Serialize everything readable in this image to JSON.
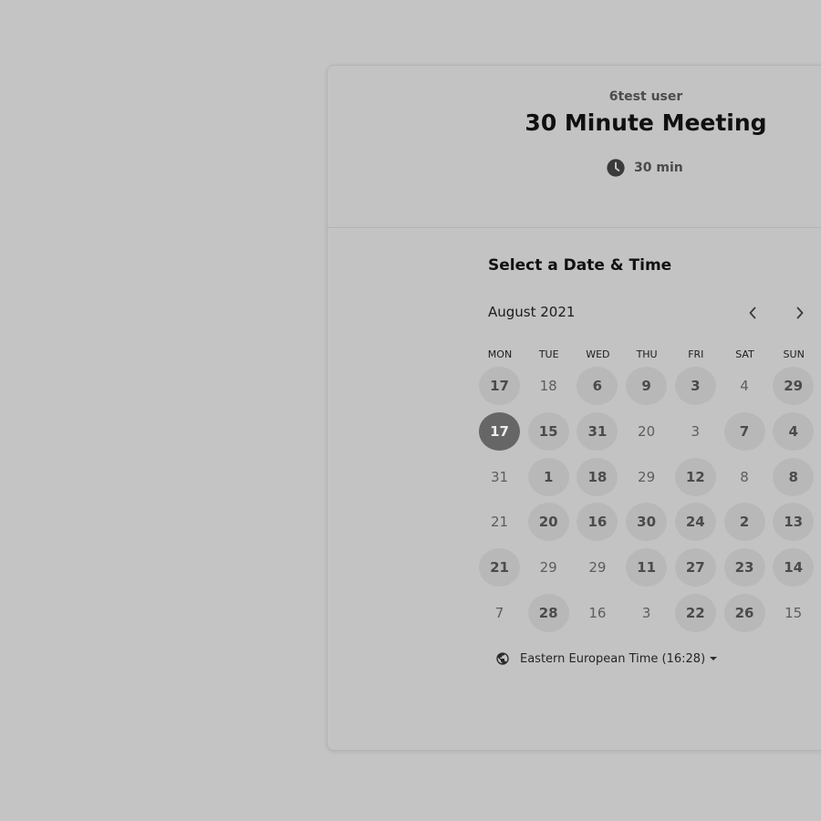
{
  "event": {
    "owner": "6test user",
    "title": "30 Minute Meeting",
    "duration": "30 min"
  },
  "calendar": {
    "section_title": "Select a Date & Time",
    "month_label": "August 2021",
    "weekdays": [
      "MON",
      "TUE",
      "WED",
      "THU",
      "FRI",
      "SAT",
      "SUN"
    ],
    "weeks": [
      [
        {
          "label": "17",
          "state": "available"
        },
        {
          "label": "18",
          "state": "disabled"
        },
        {
          "label": "6",
          "state": "available"
        },
        {
          "label": "9",
          "state": "available"
        },
        {
          "label": "3",
          "state": "available"
        },
        {
          "label": "4",
          "state": "disabled"
        },
        {
          "label": "29",
          "state": "available"
        }
      ],
      [
        {
          "label": "17",
          "state": "selected"
        },
        {
          "label": "15",
          "state": "available"
        },
        {
          "label": "31",
          "state": "available"
        },
        {
          "label": "20",
          "state": "disabled"
        },
        {
          "label": "3",
          "state": "disabled"
        },
        {
          "label": "7",
          "state": "available"
        },
        {
          "label": "4",
          "state": "available"
        }
      ],
      [
        {
          "label": "31",
          "state": "disabled"
        },
        {
          "label": "1",
          "state": "available"
        },
        {
          "label": "18",
          "state": "available"
        },
        {
          "label": "29",
          "state": "disabled"
        },
        {
          "label": "12",
          "state": "available"
        },
        {
          "label": "8",
          "state": "disabled"
        },
        {
          "label": "8",
          "state": "available"
        }
      ],
      [
        {
          "label": "21",
          "state": "disabled"
        },
        {
          "label": "20",
          "state": "available"
        },
        {
          "label": "16",
          "state": "available"
        },
        {
          "label": "30",
          "state": "available"
        },
        {
          "label": "24",
          "state": "available"
        },
        {
          "label": "2",
          "state": "available"
        },
        {
          "label": "13",
          "state": "available"
        }
      ],
      [
        {
          "label": "21",
          "state": "available"
        },
        {
          "label": "29",
          "state": "disabled"
        },
        {
          "label": "29",
          "state": "disabled"
        },
        {
          "label": "11",
          "state": "available"
        },
        {
          "label": "27",
          "state": "available"
        },
        {
          "label": "23",
          "state": "available"
        },
        {
          "label": "14",
          "state": "available"
        }
      ],
      [
        {
          "label": "7",
          "state": "disabled"
        },
        {
          "label": "28",
          "state": "available"
        },
        {
          "label": "16",
          "state": "disabled"
        },
        {
          "label": "3",
          "state": "disabled"
        },
        {
          "label": "22",
          "state": "available"
        },
        {
          "label": "26",
          "state": "available"
        },
        {
          "label": "15",
          "state": "disabled"
        }
      ]
    ]
  },
  "timezone": {
    "label": "Eastern European Time (16:28)"
  },
  "icons": {
    "duration": "clock-icon",
    "prev": "chevron-left-icon",
    "next": "chevron-right-icon",
    "timezone": "globe-icon",
    "dropdown": "caret-down-icon"
  }
}
